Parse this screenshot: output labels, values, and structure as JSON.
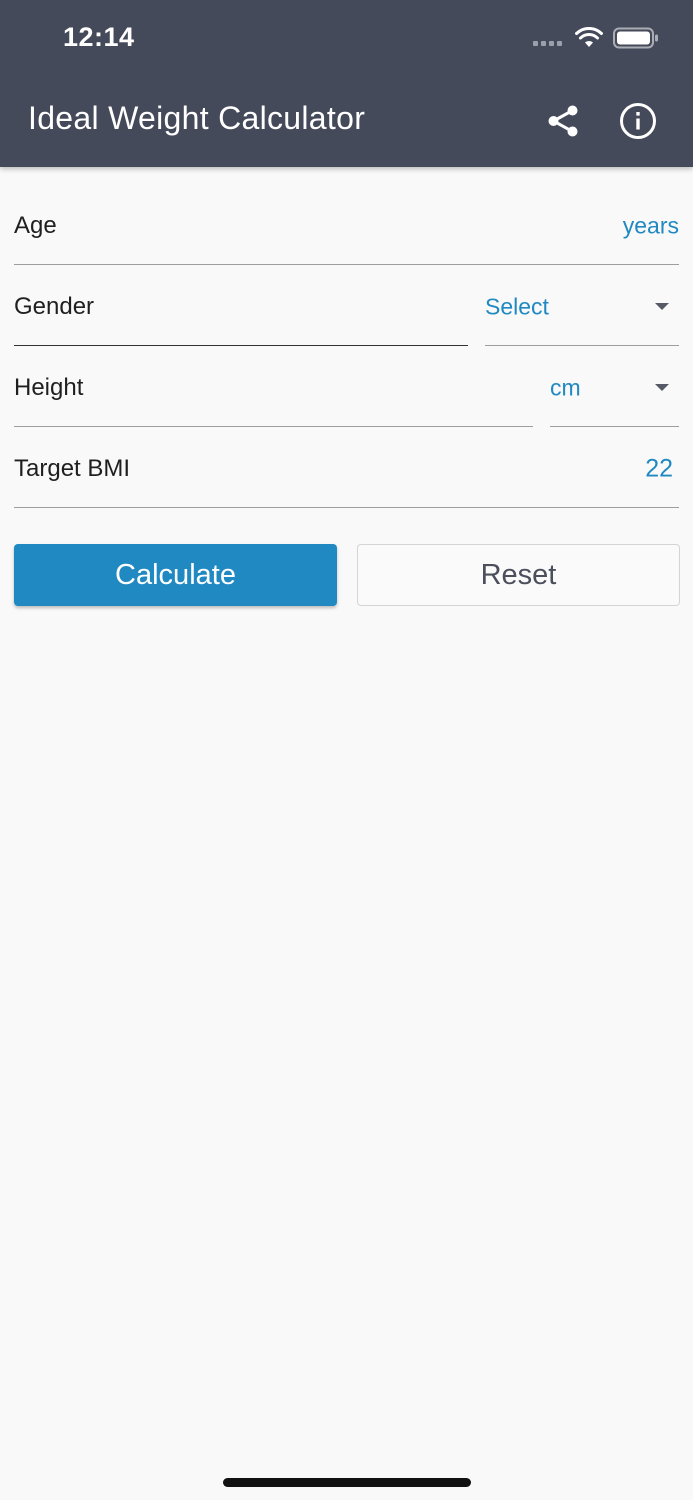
{
  "status_bar": {
    "time": "12:14"
  },
  "appbar": {
    "title": "Ideal Weight Calculator",
    "actions": [
      "share-icon",
      "info-icon"
    ]
  },
  "form": {
    "age": {
      "label": "Age",
      "suffix": "years"
    },
    "gender": {
      "label": "Gender",
      "selected": "Select"
    },
    "height": {
      "label": "Height",
      "unit": "cm"
    },
    "target_bmi": {
      "label": "Target BMI",
      "value": "22"
    }
  },
  "buttons": {
    "calculate": "Calculate",
    "reset": "Reset"
  },
  "colors": {
    "appbar": "#454a5a",
    "accent": "#2189c2",
    "background": "#f9f9f9"
  }
}
